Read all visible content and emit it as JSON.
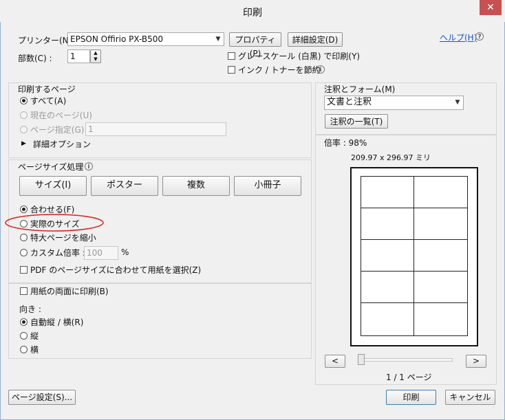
{
  "window": {
    "title": "印刷",
    "close_label": "✕"
  },
  "printer": {
    "label": "プリンター(N) :",
    "value": "EPSON Offirio PX-B500",
    "properties_btn": "プロパティ(P)",
    "advanced_btn": "詳細設定(D)",
    "help_link": "ヘルプ(H)",
    "copies_label": "部数(C) :",
    "copies_value": "1",
    "grayscale_label": "グレースケール (白黒) で印刷(Y)",
    "grayscale_checked": false,
    "save_ink_label": "インク / トナーを節約",
    "save_ink_checked": false
  },
  "pages": {
    "section_title": "印刷するページ",
    "all_label": "すべて(A)",
    "current_label": "現在のページ(U)",
    "range_label": "ページ指定(G)",
    "range_value": "1",
    "more_options": "詳細オプション"
  },
  "page_size": {
    "section_title": "ページサイズ処理",
    "tabs": [
      "サイズ(I)",
      "ポスター",
      "複数",
      "小冊子"
    ],
    "fit_label": "合わせる(F)",
    "actual_label": "実際のサイズ",
    "shrink_label": "特大ページを縮小",
    "custom_label": "カスタム倍率 :",
    "custom_value": "100",
    "custom_unit": "%",
    "pdf_size_label": "PDF のページサイズに合わせて用紙を選択(Z)",
    "pdf_size_checked": false,
    "annotation_color": "#d9211c"
  },
  "duplex": {
    "both_sides_label": "用紙の両面に印刷(B)",
    "orientation_label": "向き :",
    "auto_label": "自動縦 / 横(R)",
    "portrait_label": "縦",
    "landscape_label": "横"
  },
  "comments": {
    "section_title": "注釈とフォーム(M)",
    "value": "文書と注釈",
    "summarize_btn": "注釈の一覧(T)"
  },
  "preview": {
    "scale_label": "倍率 : 98%",
    "dimensions": "209.97 x 296.97 ミリ",
    "prev_btn": "<",
    "next_btn": ">",
    "page_indicator": "1 / 1 ページ"
  },
  "footer": {
    "page_setup_btn": "ページ設定(S)...",
    "print_btn": "印刷",
    "cancel_btn": "キャンセル"
  }
}
